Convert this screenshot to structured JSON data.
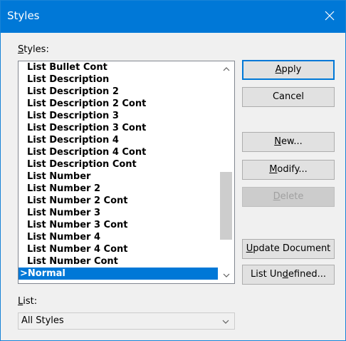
{
  "window": {
    "title": "Styles"
  },
  "styles_label": {
    "mnemonic": "S",
    "rest": "tyles:"
  },
  "list_label": {
    "mnemonic": "L",
    "rest": "ist:"
  },
  "styles_list": {
    "items": [
      "List Bullet Cont",
      "List Description",
      "List Description 2",
      "List Description 2 Cont",
      "List Description 3",
      "List Description 3 Cont",
      "List Description 4",
      "List Description 4 Cont",
      "List Description Cont",
      "List Number",
      "List Number 2",
      "List Number 2 Cont",
      "List Number 3",
      "List Number 3 Cont",
      "List Number 4",
      "List Number 4 Cont",
      "List Number Cont",
      ">Normal"
    ],
    "selected_index": 17
  },
  "buttons": {
    "apply": {
      "pre": "",
      "mnemonic": "A",
      "post": "pply"
    },
    "cancel": {
      "pre": "Cancel",
      "mnemonic": "",
      "post": ""
    },
    "new": {
      "pre": "",
      "mnemonic": "N",
      "post": "ew..."
    },
    "modify": {
      "pre": "",
      "mnemonic": "M",
      "post": "odify..."
    },
    "delete": {
      "pre": "",
      "mnemonic": "D",
      "post": "elete"
    },
    "update": {
      "pre": "",
      "mnemonic": "U",
      "post": "pdate Document"
    },
    "list_undefined": {
      "pre": "List Un",
      "mnemonic": "d",
      "post": "efined..."
    }
  },
  "list_combo": {
    "value": "All Styles"
  },
  "colors": {
    "accent": "#0078d7",
    "selection": "#0078d7",
    "disabled_text": "#a0a0a0"
  },
  "icons": {
    "close": "close-icon",
    "scroll_up": "scroll-up-arrow-icon",
    "scroll_down": "scroll-down-arrow-icon",
    "combo": "chevron-down-icon"
  }
}
